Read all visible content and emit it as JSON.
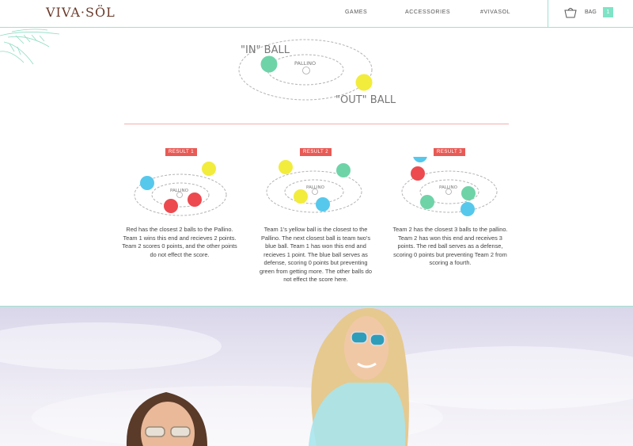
{
  "header": {
    "logo": "VIVA·SÖL",
    "nav": [
      "GAMES",
      "ACCESSORIES",
      "#VIVASOL"
    ],
    "bag_label": "BAG",
    "bag_count": "1"
  },
  "hero": {
    "in_label": "\"IN\" BALL",
    "pallino_label": "PALLINO",
    "out_label": "\"OUT\" BALL"
  },
  "results": [
    {
      "tag": "RESULT 1",
      "pallino_label": "PALLINO",
      "text": "Red has the closest 2 balls to the Pallino. Team 1 wins this end and recieves 2 points. Team 2 scores 0 points, and the other points do not effect the score."
    },
    {
      "tag": "RESULT 2",
      "pallino_label": "PALLINO",
      "text": "Team 1's yellow ball is the closest to the Pallino. The next closest ball is team two's blue ball. Team 1 has won this end and recieves 1 point. The blue ball serves as defense, scoring 0 points but preventing green from getting more. The other balls do not effect the score here."
    },
    {
      "tag": "RESULT 3",
      "pallino_label": "PALLINO",
      "text": "Team 2 has the closest 3 balls to the pallino. Team 2 has won this end and receives 3 points. The red ball serves as a defense, scoring 0 points but preventing Team 2 from scoring a fourth."
    }
  ],
  "colors": {
    "accent": "#7fe3c6",
    "tag": "#e85a55",
    "divider": "#f3b0ad",
    "brand": "#6b3a2a",
    "ball_green": "#6fd3a8",
    "ball_yellow": "#f2ec3c",
    "ball_red": "#ec4a4f",
    "ball_blue": "#56c8ec"
  }
}
